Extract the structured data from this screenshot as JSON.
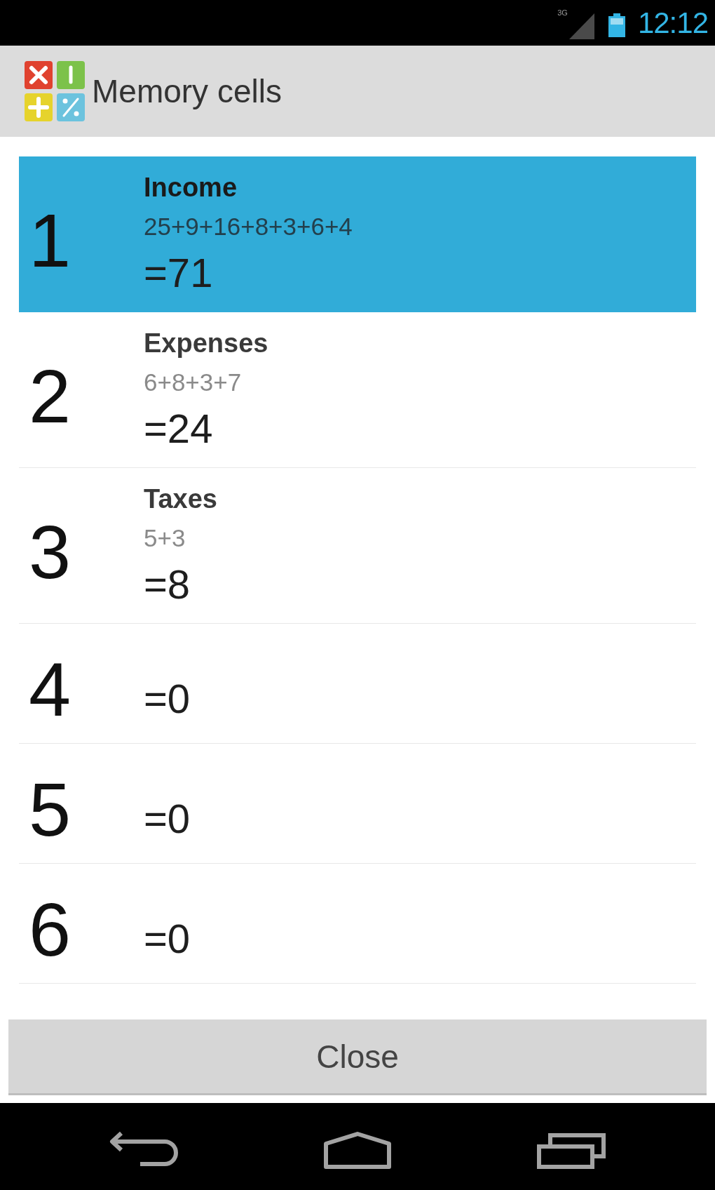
{
  "status_bar": {
    "network": "3G",
    "time": "12:12"
  },
  "action_bar": {
    "title": "Memory cells"
  },
  "cells": [
    {
      "number": "1",
      "title": "Income",
      "formula": "25+9+16+8+3+6+4",
      "result": "=71",
      "selected": true
    },
    {
      "number": "2",
      "title": "Expenses",
      "formula": "6+8+3+7",
      "result": "=24",
      "selected": false
    },
    {
      "number": "3",
      "title": "Taxes",
      "formula": "5+3",
      "result": "=8",
      "selected": false
    },
    {
      "number": "4",
      "result": "=0",
      "selected": false
    },
    {
      "number": "5",
      "result": "=0",
      "selected": false
    },
    {
      "number": "6",
      "result": "=0",
      "selected": false
    }
  ],
  "close_button": {
    "label": "Close"
  }
}
